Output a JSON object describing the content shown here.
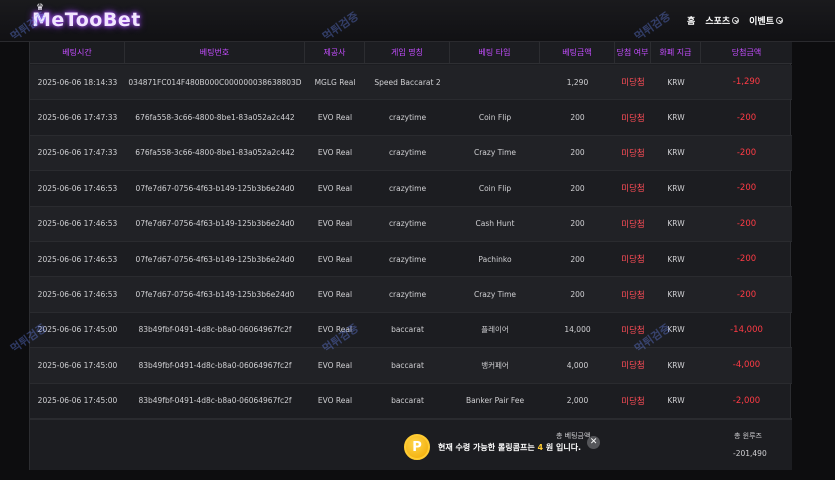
{
  "header": {
    "logo": "MeTooBet",
    "nav": [
      {
        "label": "홈",
        "has_dropdown": false
      },
      {
        "label": "스포츠",
        "has_dropdown": true
      },
      {
        "label": "이벤트",
        "has_dropdown": true
      }
    ]
  },
  "table": {
    "columns": [
      "베팅시간",
      "베팅번호",
      "제공사",
      "게임 명칭",
      "베팅 타입",
      "베팅금액",
      "당첨 여부",
      "화폐 지급",
      "당첨금액"
    ],
    "rows": [
      {
        "time": "2025-06-06 18:14:33",
        "bet_id": "034871FC014F480B000C000000038638803D",
        "provider": "MGLG Real",
        "game": "Speed Baccarat 2",
        "bet_type": "",
        "amount": "1,290",
        "status": "미당첨",
        "currency": "KRW",
        "win": "-1,290"
      },
      {
        "time": "2025-06-06 17:47:33",
        "bet_id": "676fa558-3c66-4800-8be1-83a052a2c442",
        "provider": "EVO Real",
        "game": "crazytime",
        "bet_type": "Coin Flip",
        "amount": "200",
        "status": "미당첨",
        "currency": "KRW",
        "win": "-200"
      },
      {
        "time": "2025-06-06 17:47:33",
        "bet_id": "676fa558-3c66-4800-8be1-83a052a2c442",
        "provider": "EVO Real",
        "game": "crazytime",
        "bet_type": "Crazy Time",
        "amount": "200",
        "status": "미당첨",
        "currency": "KRW",
        "win": "-200"
      },
      {
        "time": "2025-06-06 17:46:53",
        "bet_id": "07fe7d67-0756-4f63-b149-125b3b6e24d0",
        "provider": "EVO Real",
        "game": "crazytime",
        "bet_type": "Coin Flip",
        "amount": "200",
        "status": "미당첨",
        "currency": "KRW",
        "win": "-200"
      },
      {
        "time": "2025-06-06 17:46:53",
        "bet_id": "07fe7d67-0756-4f63-b149-125b3b6e24d0",
        "provider": "EVO Real",
        "game": "crazytime",
        "bet_type": "Cash Hunt",
        "amount": "200",
        "status": "미당첨",
        "currency": "KRW",
        "win": "-200"
      },
      {
        "time": "2025-06-06 17:46:53",
        "bet_id": "07fe7d67-0756-4f63-b149-125b3b6e24d0",
        "provider": "EVO Real",
        "game": "crazytime",
        "bet_type": "Pachinko",
        "amount": "200",
        "status": "미당첨",
        "currency": "KRW",
        "win": "-200"
      },
      {
        "time": "2025-06-06 17:46:53",
        "bet_id": "07fe7d67-0756-4f63-b149-125b3b6e24d0",
        "provider": "EVO Real",
        "game": "crazytime",
        "bet_type": "Crazy Time",
        "amount": "200",
        "status": "미당첨",
        "currency": "KRW",
        "win": "-200"
      },
      {
        "time": "2025-06-06 17:45:00",
        "bet_id": "83b49fbf-0491-4d8c-b8a0-06064967fc2f",
        "provider": "EVO Real",
        "game": "baccarat",
        "bet_type": "플레이어",
        "amount": "14,000",
        "status": "미당첨",
        "currency": "KRW",
        "win": "-14,000"
      },
      {
        "time": "2025-06-06 17:45:00",
        "bet_id": "83b49fbf-0491-4d8c-b8a0-06064967fc2f",
        "provider": "EVO Real",
        "game": "baccarat",
        "bet_type": "뱅커페어",
        "amount": "4,000",
        "status": "미당첨",
        "currency": "KRW",
        "win": "-4,000"
      },
      {
        "time": "2025-06-06 17:45:00",
        "bet_id": "83b49fbf-0491-4d8c-b8a0-06064967fc2f",
        "provider": "EVO Real",
        "game": "baccarat",
        "bet_type": "Banker Pair Fee",
        "amount": "2,000",
        "status": "미당첨",
        "currency": "KRW",
        "win": "-2,000"
      }
    ]
  },
  "footer": {
    "total_bet_label": "총 베팅금액",
    "total_win_label": "총 윈루즈",
    "total_win_value": "-201,490"
  },
  "toast": {
    "coin_letter": "P",
    "text_before": "현재 수령 가능한 롤링콤프는 ",
    "highlight": "4",
    "text_after": " 원 입니다.",
    "close_label": "✕"
  },
  "watermark": "먹튀검증",
  "colors": {
    "accent": "#c44dff",
    "loss": "#ff3b45",
    "coin": "#f0a800"
  }
}
